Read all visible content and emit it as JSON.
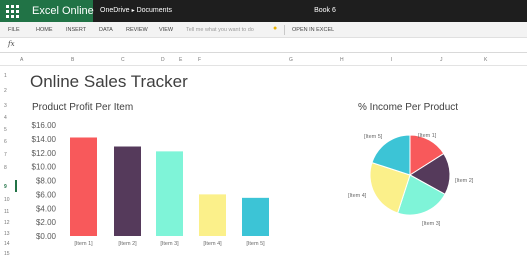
{
  "app": {
    "name": "Excel Online",
    "breadcrumb": [
      "OneDrive",
      "Documents"
    ],
    "book_title": "Book 6"
  },
  "ribbon": {
    "tabs": [
      "FILE",
      "HOME",
      "INSERT",
      "DATA",
      "REVIEW",
      "VIEW"
    ],
    "tell_me": "Tell me what you want to do",
    "open_in_excel": "OPEN IN EXCEL"
  },
  "formula_bar": {
    "fx_label": "fx"
  },
  "grid": {
    "columns": [
      "A",
      "B",
      "C",
      "D",
      "E",
      "F",
      "G",
      "H",
      "I",
      "J",
      "K"
    ],
    "rows": [
      "1",
      "2",
      "3",
      "4",
      "5",
      "6",
      "7",
      "8",
      "9",
      "10",
      "11",
      "12",
      "13",
      "14",
      "15"
    ],
    "active_row": "9"
  },
  "sheet": {
    "title": "Online Sales Tracker"
  },
  "colors": {
    "excel_green": "#217346",
    "item1": "#f8595b",
    "item2": "#553a5b",
    "item3": "#7ff4d8",
    "item4": "#fbf08a",
    "item5": "#3cc4d6"
  },
  "chart_data": [
    {
      "type": "bar",
      "title": "Product Profit Per Item",
      "categories": [
        "[Item 1]",
        "[Item 2]",
        "[Item 3]",
        "[Item 4]",
        "[Item 5]"
      ],
      "values": [
        14.2,
        12.9,
        12.2,
        6.0,
        5.5
      ],
      "ylim": [
        0,
        16
      ],
      "y_ticks": [
        "$0.00",
        "$2.00",
        "$4.00",
        "$6.00",
        "$8.00",
        "$10.00",
        "$12.00",
        "$14.00",
        "$16.00"
      ],
      "grid": false,
      "legend": "none"
    },
    {
      "type": "pie",
      "title": "% Income Per Product",
      "categories": [
        "[Item 1]",
        "[Item 2]",
        "[Item 3]",
        "[Item 4]",
        "[Item 5]"
      ],
      "values": [
        16,
        17,
        22,
        25,
        20
      ],
      "legend": "none"
    }
  ]
}
